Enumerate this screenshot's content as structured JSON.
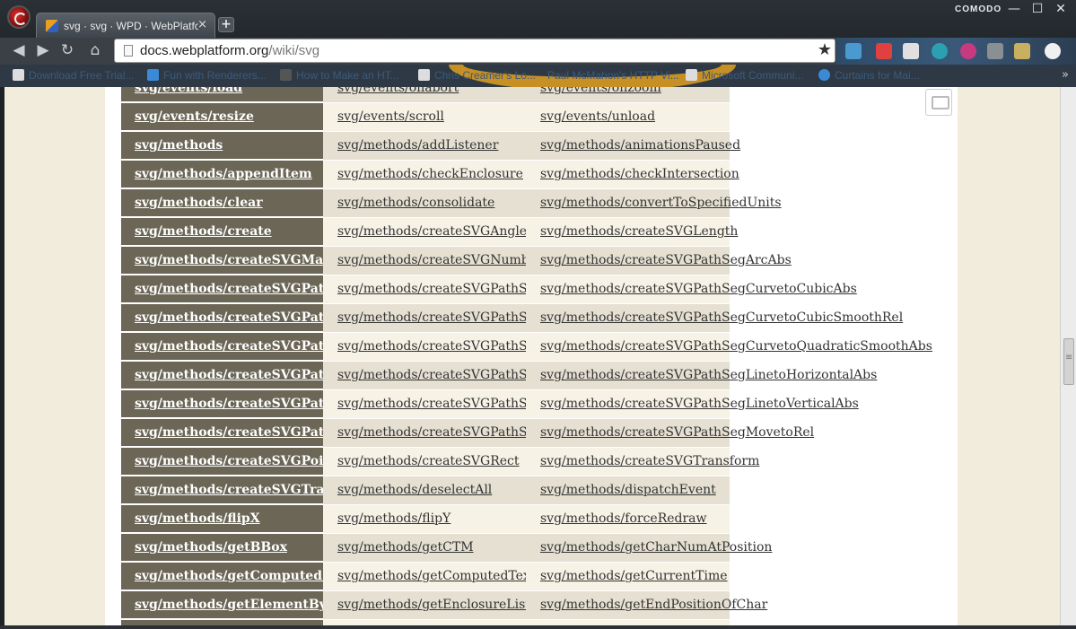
{
  "browser": {
    "brand": "COMODO",
    "tab_title": "svg · svg · WPD · WebPlatfo",
    "tab_close": "×",
    "new_tab": "+",
    "url_host": "docs.webplatform.org",
    "url_path": "/wiki/svg",
    "window": {
      "minimize": "—",
      "maximize": "☐",
      "close": "✕"
    }
  },
  "bookmarks": [
    "Download Free Trial...",
    "Fun with Renderers...",
    "How to Make an HT...",
    "Chris Creamer's Lo...",
    "Paul McMahon's HTTP Vi...",
    "Microsoft Communi...",
    "Curtains for Mai..."
  ],
  "table_rows": [
    [
      "svg/events/load",
      "svg/events/onabort",
      "svg/events/onzoom"
    ],
    [
      "svg/events/resize",
      "svg/events/scroll",
      "svg/events/unload"
    ],
    [
      "svg/methods",
      "svg/methods/addListener",
      "svg/methods/animationsPaused"
    ],
    [
      "svg/methods/appendItem",
      "svg/methods/checkEnclosure",
      "svg/methods/checkIntersection"
    ],
    [
      "svg/methods/clear",
      "svg/methods/consolidate",
      "svg/methods/convertToSpecifiedUnits"
    ],
    [
      "svg/methods/create",
      "svg/methods/createSVGAngle",
      "svg/methods/createSVGLength"
    ],
    [
      "svg/methods/createSVGMatrix",
      "svg/methods/createSVGNumber",
      "svg/methods/createSVGPathSegArcAbs"
    ],
    [
      "svg/methods/createSVGPathSegArcRel",
      "svg/methods/createSVGPathSegClosePath",
      "svg/methods/createSVGPathSegCurvetoCubicAbs"
    ],
    [
      "svg/methods/createSVGPathSegCurvetoCubicRel",
      "svg/methods/createSVGPathSegCurvetoCubicSmoothAbs",
      "svg/methods/createSVGPathSegCurvetoCubicSmoothRel"
    ],
    [
      "svg/methods/createSVGPathSegCurvetoQuadraticAbs",
      "svg/methods/createSVGPathSegCurvetoQuadraticRel",
      "svg/methods/createSVGPathSegCurvetoQuadraticSmoothAbs"
    ],
    [
      "svg/methods/createSVGPathSegLinetoAbs",
      "svg/methods/createSVGPathSegLinetoHorizontalRel",
      "svg/methods/createSVGPathSegLinetoHorizontalAbs"
    ],
    [
      "svg/methods/createSVGPathSegLinetoRel",
      "svg/methods/createSVGPathSegLinetoVerticalRel",
      "svg/methods/createSVGPathSegLinetoVerticalAbs"
    ],
    [
      "svg/methods/createSVGPathSegMovetoAbs",
      "svg/methods/createSVGPathSegMovetoAbs",
      "svg/methods/createSVGPathSegMovetoRel"
    ],
    [
      "svg/methods/createSVGPoint",
      "svg/methods/createSVGRect",
      "svg/methods/createSVGTransform"
    ],
    [
      "svg/methods/createSVGTransformFromMatrix",
      "svg/methods/deselectAll",
      "svg/methods/dispatchEvent"
    ],
    [
      "svg/methods/flipX",
      "svg/methods/flipY",
      "svg/methods/forceRedraw"
    ],
    [
      "svg/methods/getBBox",
      "svg/methods/getCTM",
      "svg/methods/getCharNumAtPosition"
    ],
    [
      "svg/methods/getComputedStyle",
      "svg/methods/getComputedTextLength",
      "svg/methods/getCurrentTime"
    ],
    [
      "svg/methods/getElementById",
      "svg/methods/getEnclosureList",
      "svg/methods/getEndPositionOfChar"
    ],
    [
      "",
      "",
      ""
    ]
  ]
}
